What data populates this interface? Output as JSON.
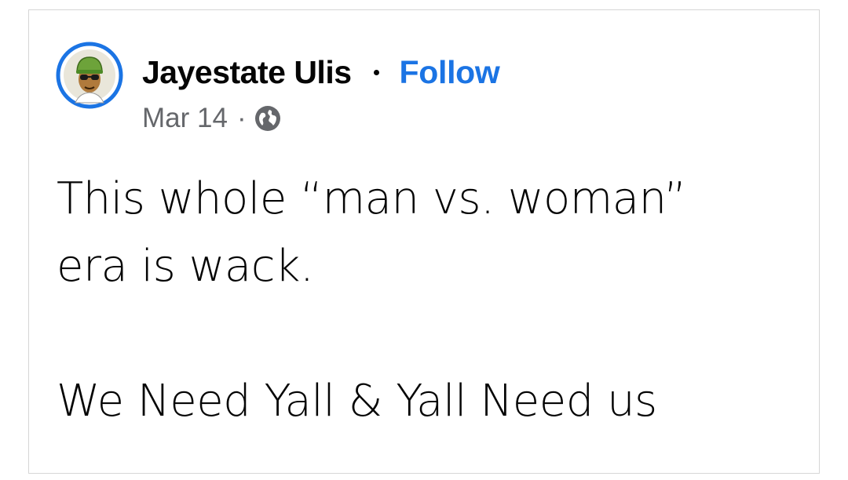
{
  "post": {
    "author": {
      "name": "Jayestate Ulis",
      "avatar_icon": "cartoon-avatar-green-hat-sunglasses-icon",
      "avatar_ring_color": "#1b74e4"
    },
    "separator": "•",
    "follow_label": "Follow",
    "date": "Mar 14",
    "meta_separator": "·",
    "privacy_icon": "globe-icon",
    "text": "This whole “man vs. woman”\nera is wack.\n\nWe Need Yall & Yall Need us"
  },
  "colors": {
    "link": "#1b74e4",
    "text": "#050505",
    "secondary_text": "#65676b",
    "border": "#d6d6d6"
  }
}
